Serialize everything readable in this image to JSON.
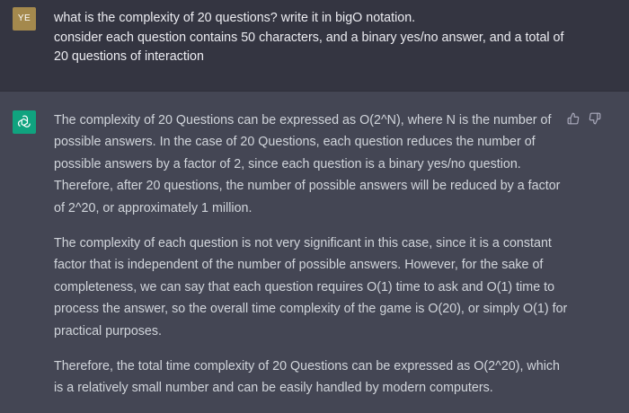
{
  "user": {
    "avatar_initials": "YE",
    "avatar_color": "#a4894d",
    "message_lines": [
      "what is the complexity of 20 questions? write it in bigO notation.",
      "consider each question contains 50 characters, and a binary yes/no answer, and a total of",
      "20 questions of interaction"
    ]
  },
  "assistant": {
    "avatar_icon": "openai-logo-icon",
    "avatar_color": "#10a37f",
    "feedback_icons": [
      "thumbs-up-icon",
      "thumbs-down-icon"
    ],
    "paragraphs": [
      {
        "lines": [
          "The complexity of 20 Questions can be expressed as O(2^N), where N is the number of",
          "possible answers. In the case of 20 Questions, each question reduces the number of",
          "possible answers by a factor of 2, since each question is a binary yes/no question.",
          "Therefore, after 20 questions, the number of possible answers will be reduced by a factor",
          "of 2^20, or approximately 1 million."
        ]
      },
      {
        "lines": [
          "The complexity of each question is not very significant in this case, since it is a constant",
          "factor that is independent of the number of possible answers. However, for the sake of",
          "completeness, we can say that each question requires O(1) time to ask and O(1) time to",
          "process the answer, so the overall time complexity of the game is O(20), or simply O(1) for",
          "practical purposes."
        ]
      },
      {
        "lines": [
          "Therefore, the total time complexity of 20 Questions can be expressed as O(2^20), which",
          "is a relatively small number and can be easily handled by modern computers."
        ]
      }
    ]
  },
  "colors": {
    "user_bg": "#343541",
    "assistant_bg": "#444654",
    "user_text": "#ececf1",
    "assistant_text": "#d1d5db"
  }
}
